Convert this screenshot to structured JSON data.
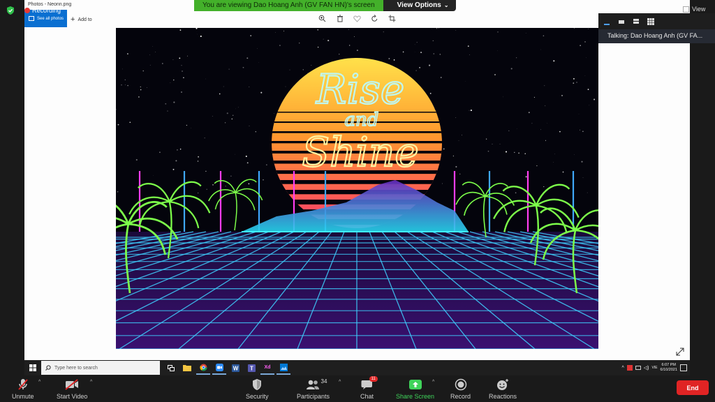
{
  "banner": {
    "viewing_text": "You are viewing Dao Hoang Anh (GV FAN HN)'s screen",
    "view_options_label": "View Options"
  },
  "photos_app": {
    "window_title": "Photos - Neonn.png",
    "recording_label": "Recording",
    "see_all_label": "See all photos",
    "add_to_label": "Add to",
    "image_text_line1": "Rise",
    "image_text_line2": "and",
    "image_text_line3": "Shine"
  },
  "taskbar": {
    "search_placeholder": "Type here to search",
    "app_xd_label": "Xd",
    "lang": "VIE",
    "time": "6:07 PM",
    "date": "6/10/2021"
  },
  "right_panel": {
    "view_label": "View",
    "talking_text": "Talking: Dao Hoang Anh (GV FA..."
  },
  "controls": {
    "unmute": "Unmute",
    "start_video": "Start Video",
    "security": "Security",
    "participants": "Participants",
    "participants_count": "34",
    "chat": "Chat",
    "chat_badge": "11",
    "share_screen": "Share Screen",
    "record": "Record",
    "reactions": "Reactions",
    "end": "End"
  },
  "colors": {
    "banner_green": "#43b02a",
    "share_green": "#3fd35a",
    "end_red": "#e02424",
    "photos_blue": "#0a6fd1"
  }
}
